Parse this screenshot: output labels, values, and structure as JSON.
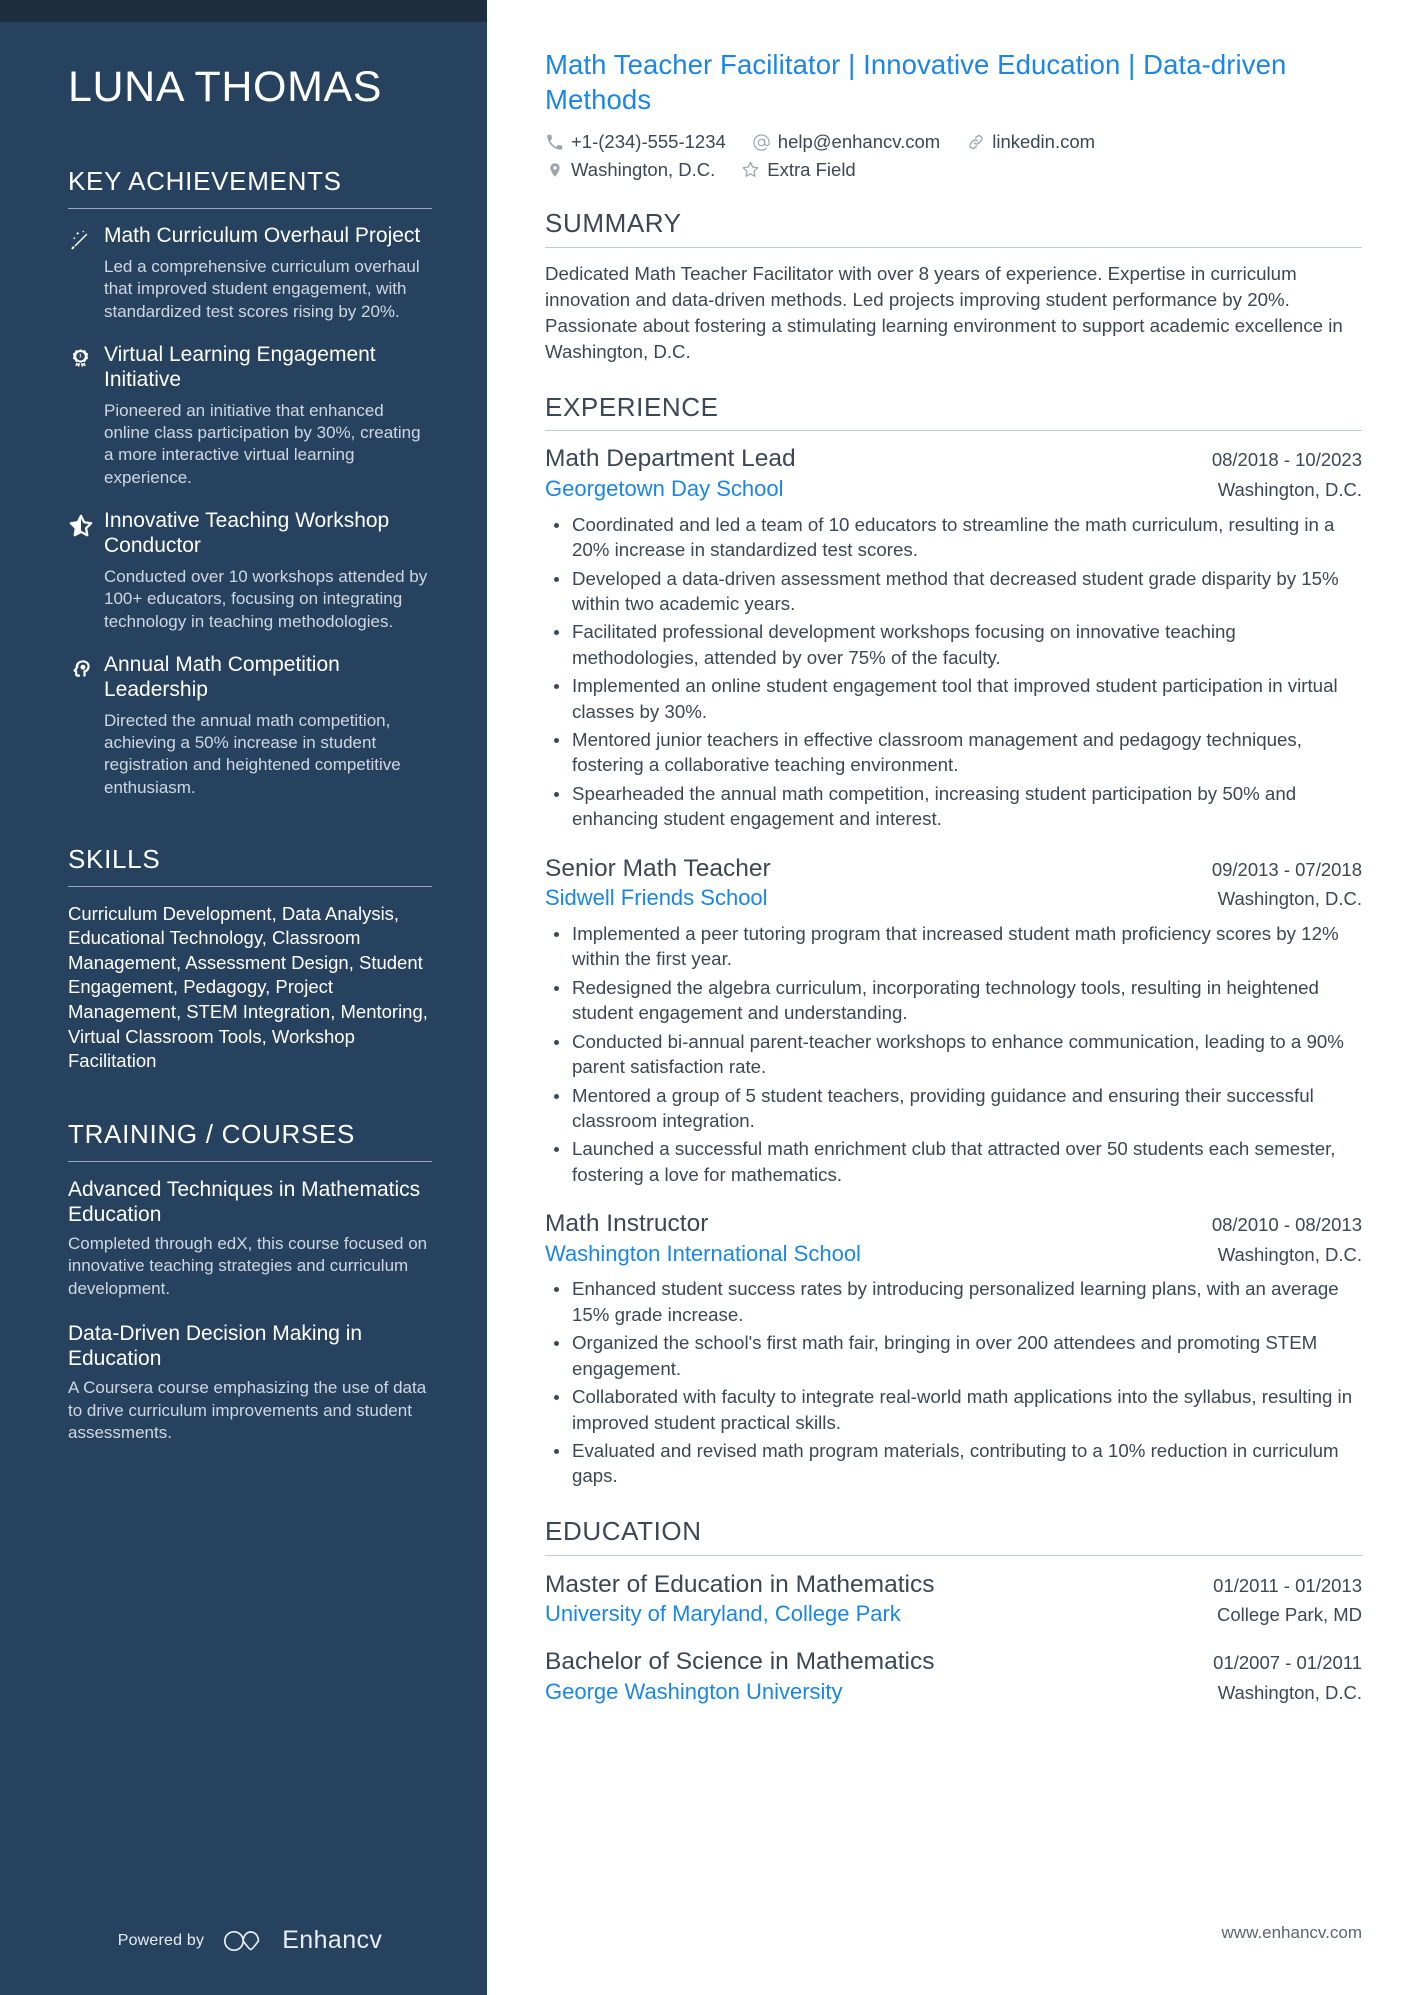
{
  "candidate": {
    "name": "LUNA THOMAS",
    "headline": "Math Teacher Facilitator | Innovative Education | Data-driven Methods"
  },
  "contact": {
    "phone": "+1-(234)-555-1234",
    "email": "help@enhancv.com",
    "website": "linkedin.com",
    "location": "Washington, D.C.",
    "extra": "Extra Field",
    "icons": {
      "phone": "phone-icon",
      "email": "at-sign-icon",
      "website": "link-icon",
      "location": "map-pin-icon",
      "extra": "star-outline-icon"
    }
  },
  "sidebar": {
    "achievements": {
      "heading": "KEY ACHIEVEMENTS",
      "items": [
        {
          "icon": "magic-wand-icon",
          "title": "Math Curriculum Overhaul Project",
          "description": "Led a comprehensive curriculum overhaul that improved student engagement, with standardized test scores rising by 20%."
        },
        {
          "icon": "award-medal-icon",
          "title": "Virtual Learning Engagement Initiative",
          "description": "Pioneered an initiative that enhanced online class participation by 30%, creating a more interactive virtual learning experience."
        },
        {
          "icon": "half-star-icon",
          "title": "Innovative Teaching Workshop Conductor",
          "description": "Conducted over 10 workshops attended by 100+ educators, focusing on integrating technology in teaching methodologies."
        },
        {
          "icon": "head-brain-icon",
          "title": "Annual Math Competition Leadership",
          "description": "Directed the annual math competition, achieving a 50% increase in student registration and heightened competitive enthusiasm."
        }
      ]
    },
    "skills": {
      "heading": "SKILLS",
      "text": "Curriculum Development, Data Analysis, Educational Technology, Classroom Management, Assessment Design, Student Engagement, Pedagogy, Project Management, STEM Integration, Mentoring, Virtual Classroom Tools, Workshop Facilitation"
    },
    "training": {
      "heading": "TRAINING / COURSES",
      "items": [
        {
          "title": "Advanced Techniques in Mathematics Education",
          "description": "Completed through edX, this course focused on innovative teaching strategies and curriculum development."
        },
        {
          "title": "Data-Driven Decision Making in Education",
          "description": "A Coursera course emphasizing the use of data to drive curriculum improvements and student assessments."
        }
      ]
    },
    "footer": {
      "powered_by": "Powered by",
      "brand": "Enhancv"
    }
  },
  "main": {
    "summary": {
      "heading": "SUMMARY",
      "text": "Dedicated Math Teacher Facilitator with over 8 years of experience. Expertise in curriculum innovation and data-driven methods. Led projects improving student performance by 20%. Passionate about fostering a stimulating learning environment to support academic excellence in Washington, D.C."
    },
    "experience": {
      "heading": "EXPERIENCE",
      "items": [
        {
          "role": "Math Department Lead",
          "dates": "08/2018 - 10/2023",
          "org": "Georgetown Day School",
          "location": "Washington, D.C.",
          "bullets": [
            "Coordinated and led a team of 10 educators to streamline the math curriculum, resulting in a 20% increase in standardized test scores.",
            "Developed a data-driven assessment method that decreased student grade disparity by 15% within two academic years.",
            "Facilitated professional development workshops focusing on innovative teaching methodologies, attended by over 75% of the faculty.",
            "Implemented an online student engagement tool that improved student participation in virtual classes by 30%.",
            "Mentored junior teachers in effective classroom management and pedagogy techniques, fostering a collaborative teaching environment.",
            "Spearheaded the annual math competition, increasing student participation by 50% and enhancing student engagement and interest."
          ]
        },
        {
          "role": "Senior Math Teacher",
          "dates": "09/2013 - 07/2018",
          "org": "Sidwell Friends School",
          "location": "Washington, D.C.",
          "bullets": [
            "Implemented a peer tutoring program that increased student math proficiency scores by 12% within the first year.",
            "Redesigned the algebra curriculum, incorporating technology tools, resulting in heightened student engagement and understanding.",
            "Conducted bi-annual parent-teacher workshops to enhance communication, leading to a 90% parent satisfaction rate.",
            "Mentored a group of 5 student teachers, providing guidance and ensuring their successful classroom integration.",
            "Launched a successful math enrichment club that attracted over 50 students each semester, fostering a love for mathematics."
          ]
        },
        {
          "role": "Math Instructor",
          "dates": "08/2010 - 08/2013",
          "org": "Washington International School",
          "location": "Washington, D.C.",
          "bullets": [
            "Enhanced student success rates by introducing personalized learning plans, with an average 15% grade increase.",
            "Organized the school's first math fair, bringing in over 200 attendees and promoting STEM engagement.",
            "Collaborated with faculty to integrate real-world math applications into the syllabus, resulting in improved student practical skills.",
            "Evaluated and revised math program materials, contributing to a 10% reduction in curriculum gaps."
          ]
        }
      ]
    },
    "education": {
      "heading": "EDUCATION",
      "items": [
        {
          "degree": "Master of Education in Mathematics",
          "dates": "01/2011 - 01/2013",
          "school": "University of Maryland, College Park",
          "location": "College Park, MD"
        },
        {
          "degree": "Bachelor of Science in Mathematics",
          "dates": "01/2007 - 01/2011",
          "school": "George Washington University",
          "location": "Washington, D.C."
        }
      ]
    },
    "footer_url": "www.enhancv.com"
  },
  "colors": {
    "sidebar_bg": "#27425f",
    "sidebar_topbar": "#1c2e40",
    "accent_blue": "#1a86e8",
    "body_text": "#3b4754"
  }
}
